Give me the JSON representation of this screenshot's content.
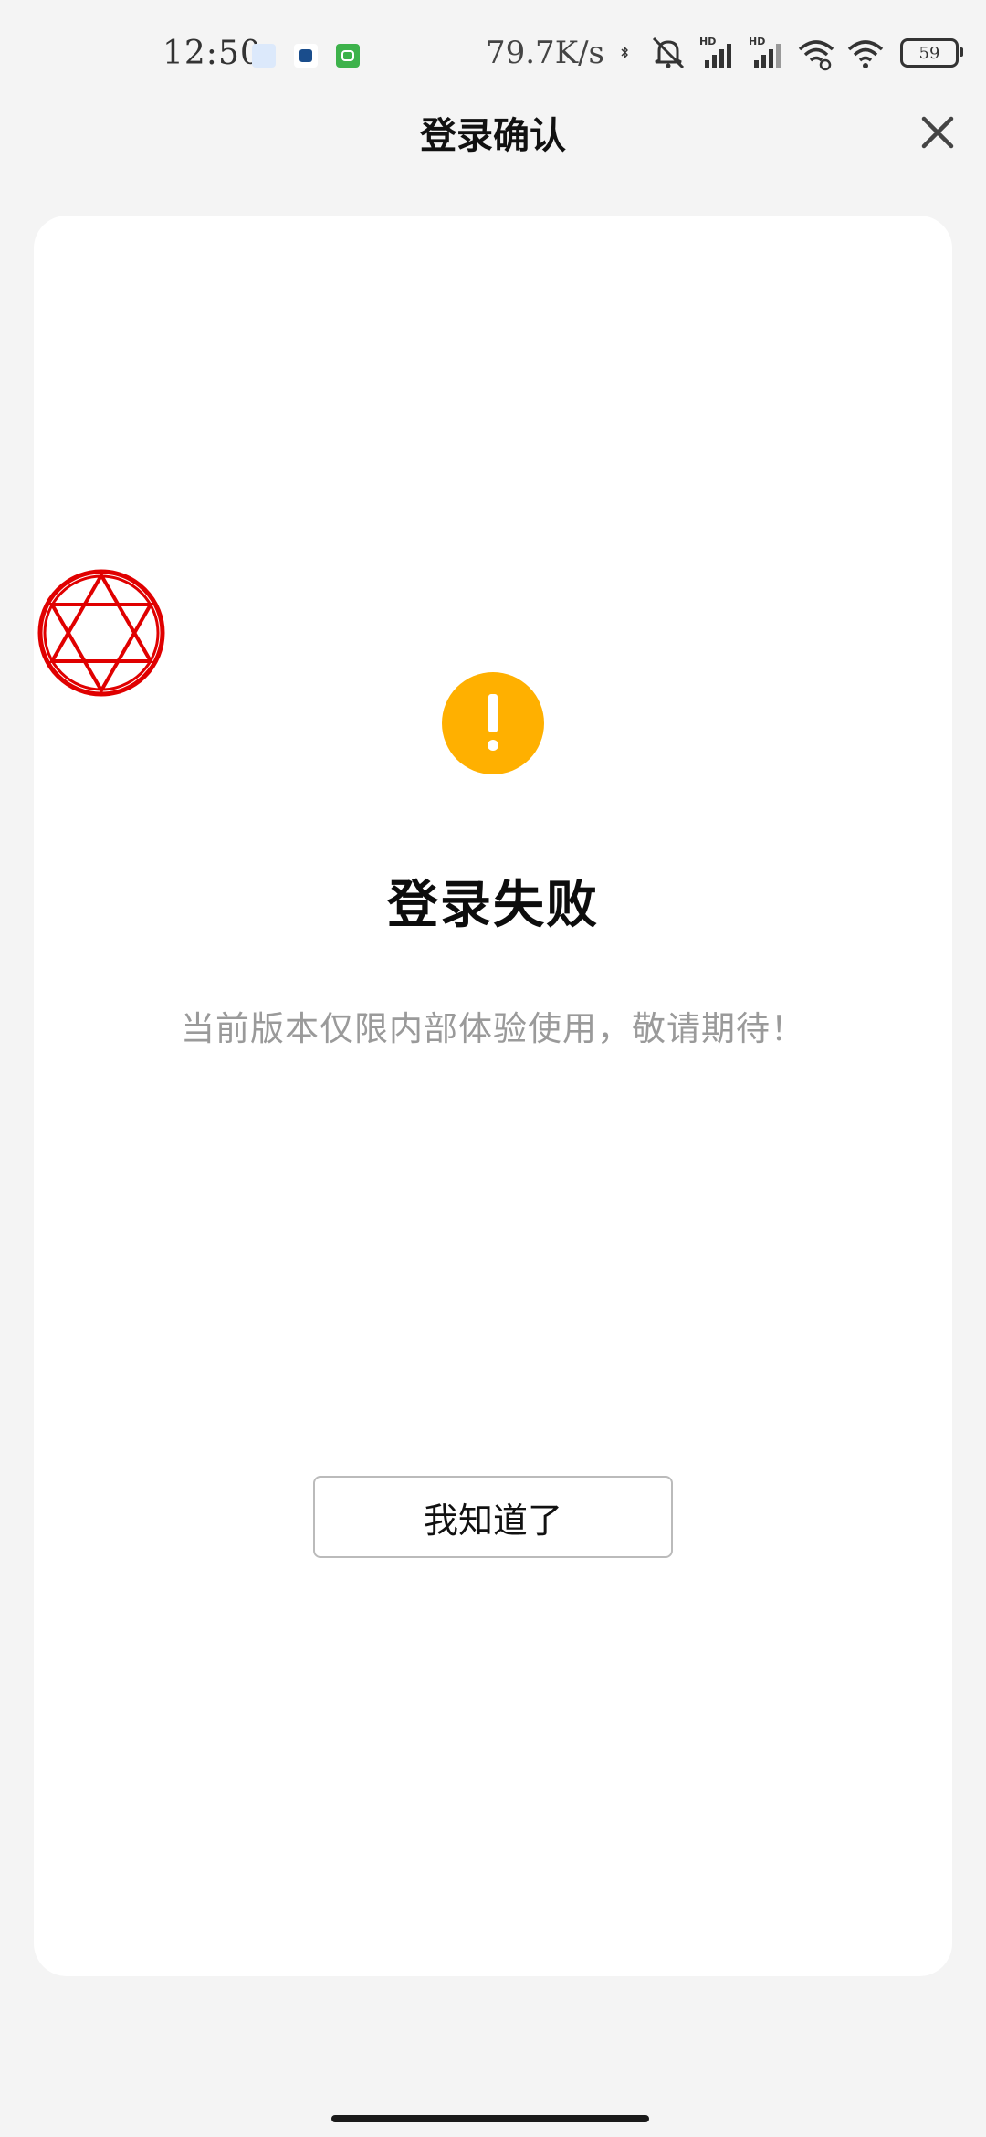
{
  "status_bar": {
    "time": "12:50",
    "net_speed": "79.7K/s",
    "battery": "59",
    "app_icons": [
      "image-notification-icon",
      "cat-app-icon",
      "green-app-icon"
    ],
    "system_icons": [
      "bluetooth-icon",
      "mute-icon",
      "signal-hd-icon",
      "signal-hd-icon",
      "wifi-link-icon",
      "wifi-icon"
    ]
  },
  "header": {
    "title": "登录确认",
    "close_icon": "close-icon"
  },
  "card": {
    "status_icon": "warning-icon",
    "status_color": "#ffb000",
    "title": "登录失败",
    "message": "当前版本仅限内部体验使用，敬请期待！",
    "button_label": "我知道了",
    "overlay_badge_icon": "hexagram-badge-icon",
    "overlay_badge_color": "#e00000"
  },
  "colors": {
    "background": "#f4f4f4",
    "card": "#ffffff",
    "message_text": "#9a9a9a"
  }
}
